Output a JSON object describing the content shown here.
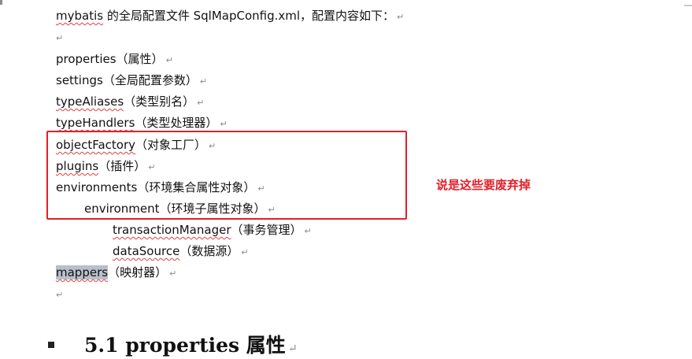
{
  "doc": {
    "intro": {
      "word": "mybatis",
      "rest": " 的全局配置文件 SqlMapConfig.xml，配置内容如下："
    },
    "blank1": "",
    "items": [
      {
        "key": "properties",
        "desc": "（属性）"
      },
      {
        "key": "settings",
        "desc": "（全局配置参数）"
      },
      {
        "key": "typeAliases",
        "desc": "（类型别名）"
      },
      {
        "key": "typeHandlers",
        "desc": "（类型处理器）"
      },
      {
        "key": "objectFactory",
        "desc": "（对象工厂）"
      },
      {
        "key": "plugins",
        "desc": "（插件）"
      },
      {
        "key": "environments",
        "desc": "（环境集合属性对象）"
      },
      {
        "key": "environment",
        "desc": "（环境子属性对象）"
      },
      {
        "key": "transactionManager",
        "desc": "（事务管理）"
      },
      {
        "key": "dataSource",
        "desc": "（数据源）"
      },
      {
        "key": "mappers",
        "desc": "（映射器）"
      }
    ],
    "paragraph_mark": "↵",
    "annotation": "说是这些要废弃掉",
    "heading": "5.1 properties 属性"
  },
  "colors": {
    "highlight_box": "#e0202a",
    "annotation_text": "#e0202a",
    "selection": "#b9bfcc",
    "spell_underline": "#e04040"
  }
}
